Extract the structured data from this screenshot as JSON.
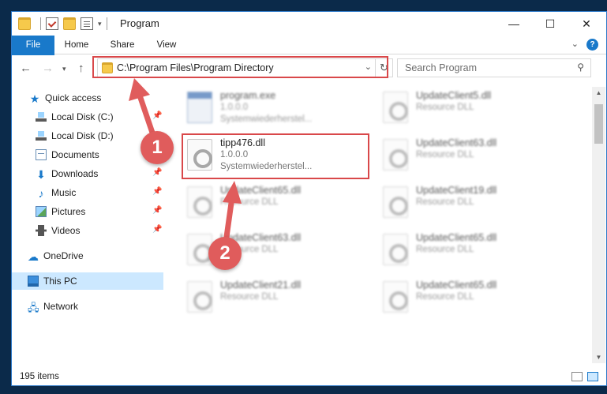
{
  "titlebar": {
    "title": "Program"
  },
  "window_controls": {
    "minimize": "—",
    "maximize": "☐",
    "close": "✕"
  },
  "ribbon": {
    "tabs": [
      "File",
      "Home",
      "Share",
      "View"
    ]
  },
  "address": {
    "path": "C:\\Program Files\\Program Directory"
  },
  "search": {
    "placeholder": "Search Program"
  },
  "nav": {
    "items": [
      {
        "label": "Quick access"
      },
      {
        "label": "Local Disk (C:)"
      },
      {
        "label": "Local Disk (D:)"
      },
      {
        "label": "Documents"
      },
      {
        "label": "Downloads"
      },
      {
        "label": "Music"
      },
      {
        "label": "Pictures"
      },
      {
        "label": "Videos"
      },
      {
        "label": "OneDrive"
      },
      {
        "label": "This PC"
      },
      {
        "label": "Network"
      }
    ]
  },
  "files": [
    {
      "name": "program.exe",
      "line2": "1.0.0.0",
      "line3": "Systemwiederherstel..."
    },
    {
      "name": "tipp476.dll",
      "line2": "1.0.0.0",
      "line3": "Systemwiederherstel..."
    },
    {
      "name": "UpdateClient65.dll",
      "line2": "Resource DLL"
    },
    {
      "name": "UpdateClient63.dll",
      "line2": "Resource DLL"
    },
    {
      "name": "UpdateClient21.dll",
      "line2": "Resource DLL"
    },
    {
      "name": "UpdateClient5.dll",
      "line2": "Resource DLL"
    },
    {
      "name": "UpdateClient63.dll",
      "line2": "Resource DLL"
    },
    {
      "name": "UpdateClient19.dll",
      "line2": "Resource DLL"
    },
    {
      "name": "UpdateClient65.dll",
      "line2": "Resource DLL"
    },
    {
      "name": "UpdateClient65.dll",
      "line2": "Resource DLL"
    }
  ],
  "status": {
    "count": "195 items"
  },
  "annotations": {
    "one": "1",
    "two": "2"
  },
  "colors": {
    "accent": "#1979ca",
    "highlight": "#d9484a",
    "selected": "#cce8ff"
  }
}
